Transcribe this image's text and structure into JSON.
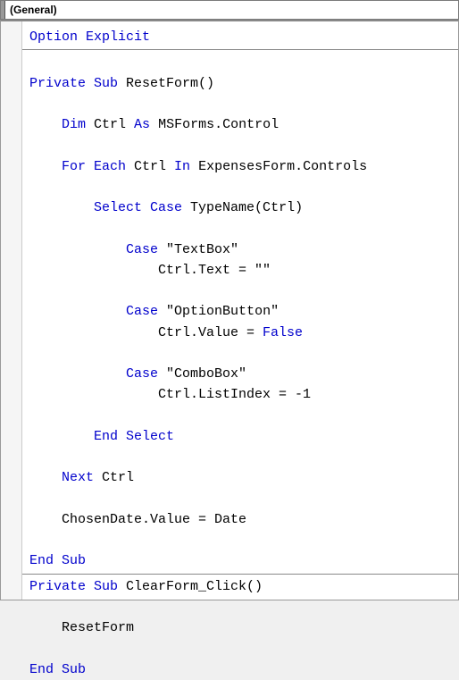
{
  "dropdown": {
    "label": "(General)"
  },
  "code": {
    "lines": [
      [
        {
          "t": "kw",
          "v": "Option Explicit"
        }
      ],
      "HR",
      [
        {
          "t": "txt",
          "v": ""
        }
      ],
      [
        {
          "t": "kw",
          "v": "Private Sub"
        },
        {
          "t": "txt",
          "v": " ResetForm()"
        }
      ],
      [
        {
          "t": "txt",
          "v": ""
        }
      ],
      [
        {
          "t": "txt",
          "v": "    "
        },
        {
          "t": "kw",
          "v": "Dim"
        },
        {
          "t": "txt",
          "v": " Ctrl "
        },
        {
          "t": "kw",
          "v": "As"
        },
        {
          "t": "txt",
          "v": " MSForms.Control"
        }
      ],
      [
        {
          "t": "txt",
          "v": ""
        }
      ],
      [
        {
          "t": "txt",
          "v": "    "
        },
        {
          "t": "kw",
          "v": "For Each"
        },
        {
          "t": "txt",
          "v": " Ctrl "
        },
        {
          "t": "kw",
          "v": "In"
        },
        {
          "t": "txt",
          "v": " ExpensesForm.Controls"
        }
      ],
      [
        {
          "t": "txt",
          "v": ""
        }
      ],
      [
        {
          "t": "txt",
          "v": "        "
        },
        {
          "t": "kw",
          "v": "Select Case"
        },
        {
          "t": "txt",
          "v": " TypeName(Ctrl)"
        }
      ],
      [
        {
          "t": "txt",
          "v": ""
        }
      ],
      [
        {
          "t": "txt",
          "v": "            "
        },
        {
          "t": "kw",
          "v": "Case"
        },
        {
          "t": "txt",
          "v": " \"TextBox\""
        }
      ],
      [
        {
          "t": "txt",
          "v": "                Ctrl.Text = \"\""
        }
      ],
      [
        {
          "t": "txt",
          "v": ""
        }
      ],
      [
        {
          "t": "txt",
          "v": "            "
        },
        {
          "t": "kw",
          "v": "Case"
        },
        {
          "t": "txt",
          "v": " \"OptionButton\""
        }
      ],
      [
        {
          "t": "txt",
          "v": "                Ctrl.Value = "
        },
        {
          "t": "kw",
          "v": "False"
        }
      ],
      [
        {
          "t": "txt",
          "v": ""
        }
      ],
      [
        {
          "t": "txt",
          "v": "            "
        },
        {
          "t": "kw",
          "v": "Case"
        },
        {
          "t": "txt",
          "v": " \"ComboBox\""
        }
      ],
      [
        {
          "t": "txt",
          "v": "                Ctrl.ListIndex = -1"
        }
      ],
      [
        {
          "t": "txt",
          "v": ""
        }
      ],
      [
        {
          "t": "txt",
          "v": "        "
        },
        {
          "t": "kw",
          "v": "End Select"
        }
      ],
      [
        {
          "t": "txt",
          "v": ""
        }
      ],
      [
        {
          "t": "txt",
          "v": "    "
        },
        {
          "t": "kw",
          "v": "Next"
        },
        {
          "t": "txt",
          "v": " Ctrl"
        }
      ],
      [
        {
          "t": "txt",
          "v": ""
        }
      ],
      [
        {
          "t": "txt",
          "v": "    ChosenDate.Value = Date"
        }
      ],
      [
        {
          "t": "txt",
          "v": ""
        }
      ],
      [
        {
          "t": "kw",
          "v": "End Sub"
        }
      ],
      "HR",
      [
        {
          "t": "kw",
          "v": "Private Sub"
        },
        {
          "t": "txt",
          "v": " ClearForm_Click()"
        }
      ],
      [
        {
          "t": "txt",
          "v": ""
        }
      ],
      [
        {
          "t": "txt",
          "v": "    ResetForm"
        }
      ],
      [
        {
          "t": "txt",
          "v": ""
        }
      ],
      [
        {
          "t": "kw",
          "v": "End Sub"
        }
      ]
    ]
  }
}
